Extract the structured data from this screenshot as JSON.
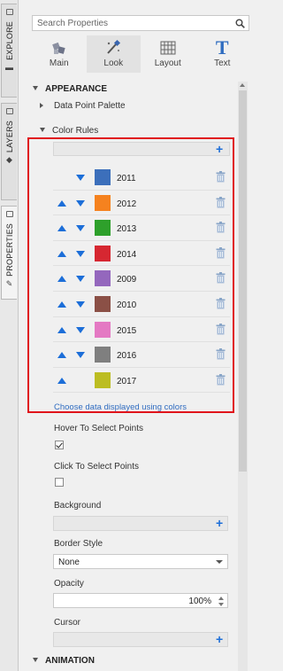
{
  "side_tabs": [
    {
      "label": "EXPLORE"
    },
    {
      "label": "LAYERS"
    },
    {
      "label": "PROPERTIES"
    }
  ],
  "search": {
    "placeholder": "Search Properties"
  },
  "category_tabs": [
    {
      "label": "Main",
      "icon": "main-icon"
    },
    {
      "label": "Look",
      "icon": "look-icon",
      "active": true
    },
    {
      "label": "Layout",
      "icon": "layout-icon"
    },
    {
      "label": "Text",
      "icon": "text-icon"
    }
  ],
  "appearance": {
    "header": "APPEARANCE",
    "data_point_palette": "Data Point Palette",
    "color_rules": {
      "header": "Color Rules",
      "rules": [
        {
          "value": "2011",
          "color": "#3c6fbb"
        },
        {
          "value": "2012",
          "color": "#f5821f"
        },
        {
          "value": "2013",
          "color": "#2ea02b"
        },
        {
          "value": "2014",
          "color": "#d62731"
        },
        {
          "value": "2009",
          "color": "#9467bd"
        },
        {
          "value": "2010",
          "color": "#8b5046"
        },
        {
          "value": "2015",
          "color": "#e479c3"
        },
        {
          "value": "2016",
          "color": "#7f7f7f"
        },
        {
          "value": "2017",
          "color": "#bcbd22"
        }
      ],
      "link": "Choose data displayed using colors"
    },
    "hover_to_select": {
      "label": "Hover To Select Points",
      "checked": true
    },
    "click_to_select": {
      "label": "Click To Select Points",
      "checked": false
    },
    "background": {
      "label": "Background"
    },
    "border_style": {
      "label": "Border Style",
      "value": "None"
    },
    "opacity": {
      "label": "Opacity",
      "value": "100%"
    },
    "cursor": {
      "label": "Cursor"
    }
  },
  "animation": {
    "header": "ANIMATION"
  },
  "colors": {
    "accent": "#1c6ed8",
    "highlight": "#e0141b"
  }
}
